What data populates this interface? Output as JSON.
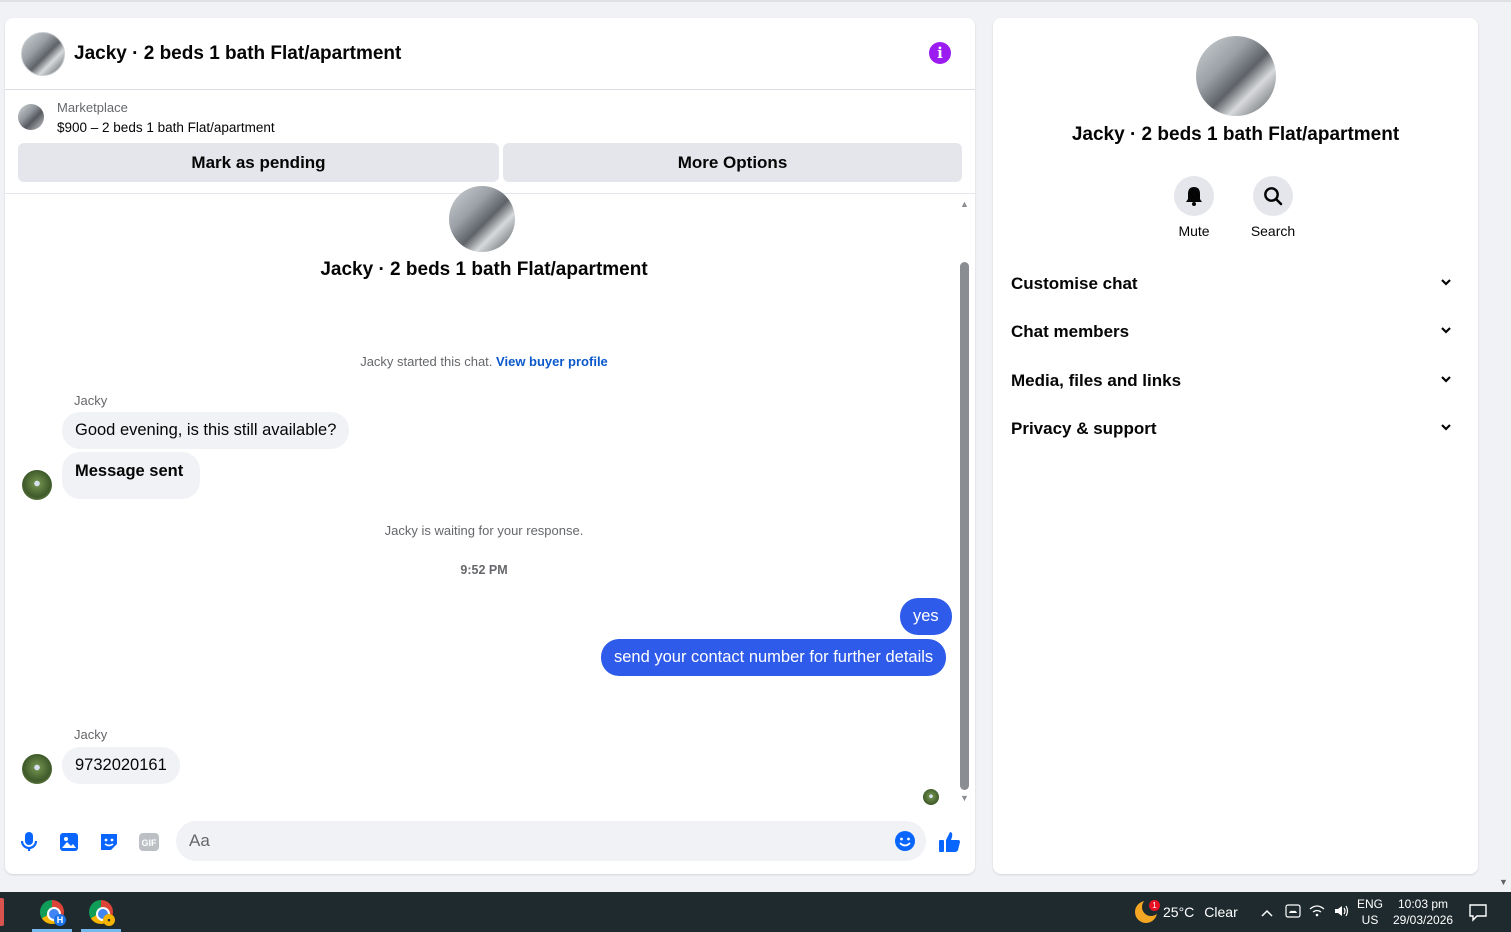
{
  "chat": {
    "title": "Jacky · 2 beds 1 bath Flat/apartment",
    "listing": {
      "source": "Marketplace",
      "price_title": "$900 – 2 beds 1 bath Flat/apartment"
    },
    "buttons": {
      "mark_pending": "Mark as pending",
      "more_options": "More Options"
    },
    "conversation_title": "Jacky · 2 beds 1 bath Flat/apartment",
    "started_text": "Jacky started this chat.",
    "view_profile_link": "View buyer profile",
    "messages": [
      {
        "sender": "Jacky",
        "text": "Good evening, is this still available?"
      },
      {
        "text": "Message sent"
      }
    ],
    "waiting_text": "Jacky is waiting for your response.",
    "timestamp": "9:52 PM",
    "outgoing": [
      {
        "text": "yes"
      },
      {
        "text": "send your contact number for further details"
      }
    ],
    "reply": {
      "sender": "Jacky",
      "text": "9732020161"
    },
    "composer": {
      "placeholder": "Aa"
    }
  },
  "info_panel": {
    "title": "Jacky · 2 beds 1 bath Flat/apartment",
    "actions": [
      {
        "label": "Mute",
        "icon": "bell-icon"
      },
      {
        "label": "Search",
        "icon": "search-icon"
      }
    ],
    "sections": [
      {
        "label": "Customise chat"
      },
      {
        "label": "Chat members"
      },
      {
        "label": "Media, files and links"
      },
      {
        "label": "Privacy & support"
      }
    ]
  },
  "taskbar": {
    "weather_temp": "25°C",
    "weather_desc": "Clear",
    "weather_badge": "1",
    "lang_top": "ENG",
    "lang_bottom": "US",
    "time": "10:03 pm",
    "date": "29/03/2026",
    "chrome_badge": "H"
  },
  "colors": {
    "accent": "#2e5bea",
    "info_purple": "#9b1cf0",
    "link": "#0a58ca",
    "taskbar_bg": "#1f2a2e"
  }
}
